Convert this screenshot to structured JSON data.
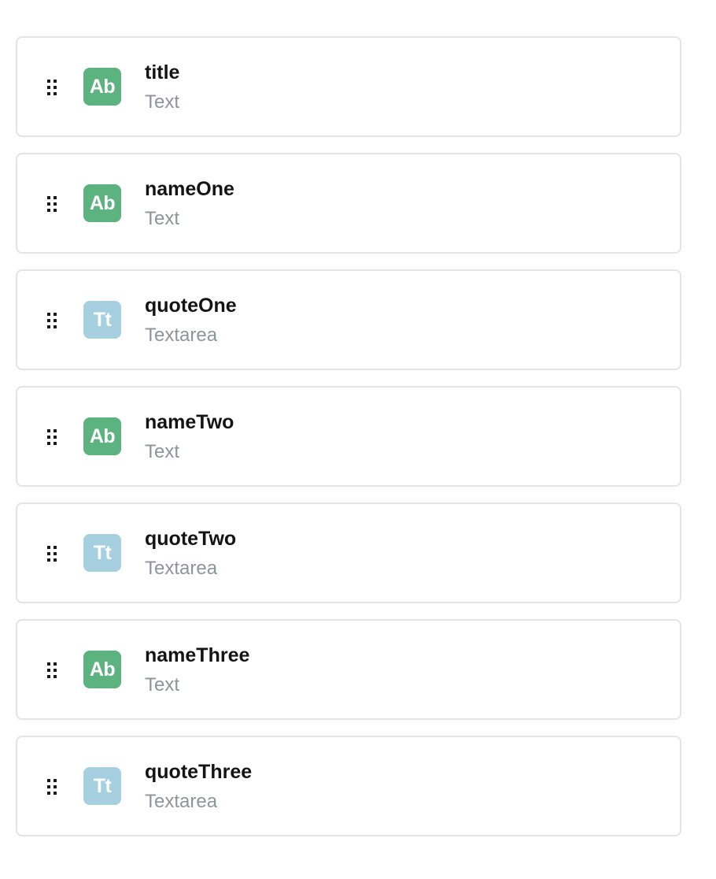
{
  "fields": [
    {
      "name": "title",
      "type": "Text",
      "badge": "Ab",
      "badge_icon": "text-type-icon",
      "badge_color": "#5db380"
    },
    {
      "name": "nameOne",
      "type": "Text",
      "badge": "Ab",
      "badge_icon": "text-type-icon",
      "badge_color": "#5db380"
    },
    {
      "name": "quoteOne",
      "type": "Textarea",
      "badge": "Tt",
      "badge_icon": "textarea-type-icon",
      "badge_color": "#a6cfdf"
    },
    {
      "name": "nameTwo",
      "type": "Text",
      "badge": "Ab",
      "badge_icon": "text-type-icon",
      "badge_color": "#5db380"
    },
    {
      "name": "quoteTwo",
      "type": "Textarea",
      "badge": "Tt",
      "badge_icon": "textarea-type-icon",
      "badge_color": "#a6cfdf"
    },
    {
      "name": "nameThree",
      "type": "Text",
      "badge": "Ab",
      "badge_icon": "text-type-icon",
      "badge_color": "#5db380"
    },
    {
      "name": "quoteThree",
      "type": "Textarea",
      "badge": "Tt",
      "badge_icon": "textarea-type-icon",
      "badge_color": "#a6cfdf"
    }
  ],
  "icons": {
    "drag_handle": "drag-handle-icon"
  }
}
